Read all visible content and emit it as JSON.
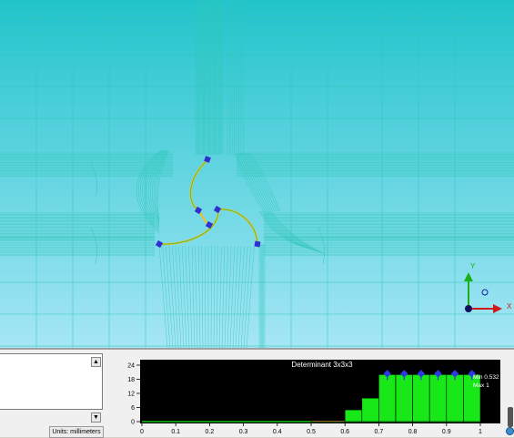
{
  "viewport": {
    "background_top": "#20c0c8",
    "background_bottom": "#a8e4f4",
    "mesh_color": "#2fc6b8",
    "curve_color": "#f0c020",
    "handle_color": "#3030d0",
    "triad": {
      "y_label": "Y",
      "x_label": "X",
      "y_color": "#18b018",
      "x_color": "#d01818",
      "origin_color": "#101060"
    }
  },
  "bottom_panel": {
    "units_label": "Units: millimeters",
    "scroll_up_icon": "▲",
    "scroll_down_icon": "▼"
  },
  "chart_data": {
    "type": "bar",
    "title": "Determinant 3x3x3",
    "min_label": "Min 0.532",
    "max_label": "Max 1",
    "x_ticks": [
      "0",
      "0.1",
      "0.2",
      "0.3",
      "0.4",
      "0.5",
      "0.6",
      "0.7",
      "0.8",
      "0.9",
      "1"
    ],
    "y_ticks": [
      "0",
      "6",
      "12",
      "18",
      "24"
    ],
    "xlim": [
      0,
      1
    ],
    "ylim": [
      0,
      24
    ],
    "bar_color": "#18e818",
    "bins": [
      {
        "x0": 0.0,
        "x1": 0.5,
        "value": 0
      },
      {
        "x0": 0.5,
        "x1": 0.6,
        "value": 0.5
      },
      {
        "x0": 0.6,
        "x1": 0.65,
        "value": 5
      },
      {
        "x0": 0.65,
        "x1": 0.7,
        "value": 10
      },
      {
        "x0": 0.7,
        "x1": 0.75,
        "value": 20
      },
      {
        "x0": 0.75,
        "x1": 0.8,
        "value": 20
      },
      {
        "x0": 0.8,
        "x1": 0.85,
        "value": 20
      },
      {
        "x0": 0.85,
        "x1": 0.9,
        "value": 20
      },
      {
        "x0": 0.9,
        "x1": 0.95,
        "value": 20
      },
      {
        "x0": 0.95,
        "x1": 1.0,
        "value": 20
      }
    ],
    "markers": [
      0.725,
      0.775,
      0.825,
      0.875,
      0.925,
      0.975
    ],
    "marker_value": 20
  }
}
